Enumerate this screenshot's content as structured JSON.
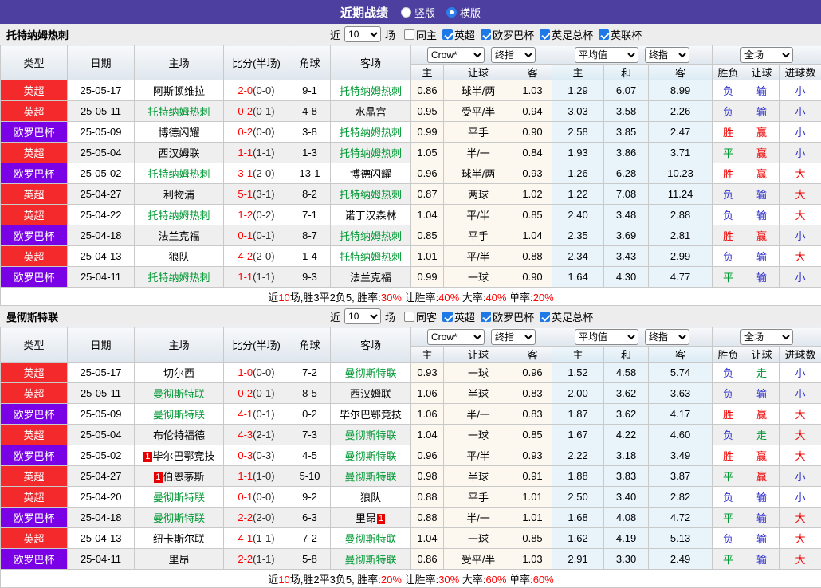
{
  "header": {
    "title": "近期战绩",
    "view_options": [
      {
        "label": "竖版",
        "checked": false
      },
      {
        "label": "横版",
        "checked": true
      }
    ]
  },
  "colors": {
    "topbar_purple": "#4c3f9f",
    "league_red": "#f4292c",
    "league_purple": "#7a00e6",
    "focus_team_green": "#009933",
    "score_red": "#ff0000",
    "win_red": "#f00000",
    "lose_blue": "#3333cc",
    "draw_green": "#009933",
    "checkbox_blue": "#1e79e6",
    "avg_col_bg": "#e9f4fa",
    "crow_col_bg": "#fcf7ef"
  },
  "table_selects": {
    "crow": "Crow*",
    "final1": "终指",
    "avg": "平均值",
    "final2": "终指",
    "full": "全场"
  },
  "columns": {
    "type": "类型",
    "date": "日期",
    "home": "主场",
    "score": "比分(半场)",
    "corner": "角球",
    "away": "客场",
    "crow_home": "主",
    "crow_handicap": "让球",
    "crow_away": "客",
    "avg_home": "主",
    "avg_draw": "和",
    "avg_away": "客",
    "result": "胜负",
    "handicap_result": "让球",
    "goals": "进球数"
  },
  "sections": [
    {
      "team": "托特纳姆热刺",
      "filter": {
        "near": "近",
        "games": "10",
        "unit": "场",
        "same": {
          "label": "同主",
          "checked": false
        },
        "leagues": [
          {
            "label": "英超",
            "checked": true
          },
          {
            "label": "欧罗巴杯",
            "checked": true
          },
          {
            "label": "英足总杯",
            "checked": true
          },
          {
            "label": "英联杯",
            "checked": true
          }
        ]
      },
      "rows": [
        {
          "type": "英超",
          "date": "25-05-17",
          "home": "阿斯顿维拉",
          "score": "2-0",
          "half": "(0-0)",
          "corner": "9-1",
          "away": "托特纳姆热刺",
          "crow_home": "0.86",
          "handicap": "球半/两",
          "crow_away": "1.03",
          "avg_home": "1.29",
          "avg_draw": "6.07",
          "avg_away": "8.99",
          "result": "负",
          "handicap_result": "输",
          "goals": "小"
        },
        {
          "type": "英超",
          "date": "25-05-11",
          "home": "托特纳姆热刺",
          "score": "0-2",
          "half": "(0-1)",
          "corner": "4-8",
          "away": "水晶宫",
          "crow_home": "0.95",
          "handicap": "受平/半",
          "crow_away": "0.94",
          "avg_home": "3.03",
          "avg_draw": "3.58",
          "avg_away": "2.26",
          "result": "负",
          "handicap_result": "输",
          "goals": "小"
        },
        {
          "type": "欧罗巴杯",
          "date": "25-05-09",
          "home": "博德闪耀",
          "score": "0-2",
          "half": "(0-0)",
          "corner": "3-8",
          "away": "托特纳姆热刺",
          "crow_home": "0.99",
          "handicap": "平手",
          "crow_away": "0.90",
          "avg_home": "2.58",
          "avg_draw": "3.85",
          "avg_away": "2.47",
          "result": "胜",
          "handicap_result": "赢",
          "goals": "小"
        },
        {
          "type": "英超",
          "date": "25-05-04",
          "home": "西汉姆联",
          "score": "1-1",
          "half": "(1-1)",
          "corner": "1-3",
          "away": "托特纳姆热刺",
          "crow_home": "1.05",
          "handicap": "半/一",
          "crow_away": "0.84",
          "avg_home": "1.93",
          "avg_draw": "3.86",
          "avg_away": "3.71",
          "result": "平",
          "handicap_result": "赢",
          "goals": "小"
        },
        {
          "type": "欧罗巴杯",
          "date": "25-05-02",
          "home": "托特纳姆热刺",
          "score": "3-1",
          "half": "(2-0)",
          "corner": "13-1",
          "away": "博德闪耀",
          "crow_home": "0.96",
          "handicap": "球半/两",
          "crow_away": "0.93",
          "avg_home": "1.26",
          "avg_draw": "6.28",
          "avg_away": "10.23",
          "result": "胜",
          "handicap_result": "赢",
          "goals": "大"
        },
        {
          "type": "英超",
          "date": "25-04-27",
          "home": "利物浦",
          "score": "5-1",
          "half": "(3-1)",
          "corner": "8-2",
          "away": "托特纳姆热刺",
          "crow_home": "0.87",
          "handicap": "两球",
          "crow_away": "1.02",
          "avg_home": "1.22",
          "avg_draw": "7.08",
          "avg_away": "11.24",
          "result": "负",
          "handicap_result": "输",
          "goals": "大"
        },
        {
          "type": "英超",
          "date": "25-04-22",
          "home": "托特纳姆热刺",
          "score": "1-2",
          "half": "(0-2)",
          "corner": "7-1",
          "away": "诺丁汉森林",
          "crow_home": "1.04",
          "handicap": "平/半",
          "crow_away": "0.85",
          "avg_home": "2.40",
          "avg_draw": "3.48",
          "avg_away": "2.88",
          "result": "负",
          "handicap_result": "输",
          "goals": "大"
        },
        {
          "type": "欧罗巴杯",
          "date": "25-04-18",
          "home": "法兰克福",
          "score": "0-1",
          "half": "(0-1)",
          "corner": "8-7",
          "away": "托特纳姆热刺",
          "crow_home": "0.85",
          "handicap": "平手",
          "crow_away": "1.04",
          "avg_home": "2.35",
          "avg_draw": "3.69",
          "avg_away": "2.81",
          "result": "胜",
          "handicap_result": "赢",
          "goals": "小"
        },
        {
          "type": "英超",
          "date": "25-04-13",
          "home": "狼队",
          "score": "4-2",
          "half": "(2-0)",
          "corner": "1-4",
          "away": "托特纳姆热刺",
          "crow_home": "1.01",
          "handicap": "平/半",
          "crow_away": "0.88",
          "avg_home": "2.34",
          "avg_draw": "3.43",
          "avg_away": "2.99",
          "result": "负",
          "handicap_result": "输",
          "goals": "大"
        },
        {
          "type": "欧罗巴杯",
          "date": "25-04-11",
          "home": "托特纳姆热刺",
          "score": "1-1",
          "half": "(1-1)",
          "corner": "9-3",
          "away": "法兰克福",
          "crow_home": "0.99",
          "handicap": "一球",
          "crow_away": "0.90",
          "avg_home": "1.64",
          "avg_draw": "4.30",
          "avg_away": "4.77",
          "result": "平",
          "handicap_result": "输",
          "goals": "小"
        }
      ],
      "summary": [
        {
          "text": "近"
        },
        {
          "text": "10",
          "red": true
        },
        {
          "text": "场,胜3平2负5, 胜率:"
        },
        {
          "text": "30%",
          "red": true
        },
        {
          "text": " 让胜率:"
        },
        {
          "text": "40%",
          "red": true
        },
        {
          "text": " 大率:"
        },
        {
          "text": "40%",
          "red": true
        },
        {
          "text": " 单率:"
        },
        {
          "text": "20%",
          "red": true
        }
      ]
    },
    {
      "team": "曼彻斯特联",
      "filter": {
        "near": "近",
        "games": "10",
        "unit": "场",
        "same": {
          "label": "同客",
          "checked": false
        },
        "leagues": [
          {
            "label": "英超",
            "checked": true
          },
          {
            "label": "欧罗巴杯",
            "checked": true
          },
          {
            "label": "英足总杯",
            "checked": true
          }
        ]
      },
      "rows": [
        {
          "type": "英超",
          "date": "25-05-17",
          "home": "切尔西",
          "score": "1-0",
          "half": "(0-0)",
          "corner": "7-2",
          "away": "曼彻斯特联",
          "crow_home": "0.93",
          "handicap": "一球",
          "crow_away": "0.96",
          "avg_home": "1.52",
          "avg_draw": "4.58",
          "avg_away": "5.74",
          "result": "负",
          "handicap_result": "走",
          "goals": "小"
        },
        {
          "type": "英超",
          "date": "25-05-11",
          "home": "曼彻斯特联",
          "score": "0-2",
          "half": "(0-1)",
          "corner": "8-5",
          "away": "西汉姆联",
          "crow_home": "1.06",
          "handicap": "半球",
          "crow_away": "0.83",
          "avg_home": "2.00",
          "avg_draw": "3.62",
          "avg_away": "3.63",
          "result": "负",
          "handicap_result": "输",
          "goals": "小"
        },
        {
          "type": "欧罗巴杯",
          "date": "25-05-09",
          "home": "曼彻斯特联",
          "score": "4-1",
          "half": "(0-1)",
          "corner": "0-2",
          "away": "毕尔巴鄂竞技",
          "crow_home": "1.06",
          "handicap": "半/一",
          "crow_away": "0.83",
          "avg_home": "1.87",
          "avg_draw": "3.62",
          "avg_away": "4.17",
          "result": "胜",
          "handicap_result": "赢",
          "goals": "大"
        },
        {
          "type": "英超",
          "date": "25-05-04",
          "home": "布伦特福德",
          "score": "4-3",
          "half": "(2-1)",
          "corner": "7-3",
          "away": "曼彻斯特联",
          "crow_home": "1.04",
          "handicap": "一球",
          "crow_away": "0.85",
          "avg_home": "1.67",
          "avg_draw": "4.22",
          "avg_away": "4.60",
          "result": "负",
          "handicap_result": "走",
          "goals": "大"
        },
        {
          "type": "欧罗巴杯",
          "date": "25-05-02",
          "home": "毕尔巴鄂竞技",
          "home_card": "1",
          "score": "0-3",
          "half": "(0-3)",
          "corner": "4-5",
          "away": "曼彻斯特联",
          "crow_home": "0.96",
          "handicap": "平/半",
          "crow_away": "0.93",
          "avg_home": "2.22",
          "avg_draw": "3.18",
          "avg_away": "3.49",
          "result": "胜",
          "handicap_result": "赢",
          "goals": "大"
        },
        {
          "type": "英超",
          "date": "25-04-27",
          "home": "伯恩茅斯",
          "home_card": "1",
          "score": "1-1",
          "half": "(1-0)",
          "corner": "5-10",
          "away": "曼彻斯特联",
          "crow_home": "0.98",
          "handicap": "半球",
          "crow_away": "0.91",
          "avg_home": "1.88",
          "avg_draw": "3.83",
          "avg_away": "3.87",
          "result": "平",
          "handicap_result": "赢",
          "goals": "小"
        },
        {
          "type": "英超",
          "date": "25-04-20",
          "home": "曼彻斯特联",
          "score": "0-1",
          "half": "(0-0)",
          "corner": "9-2",
          "away": "狼队",
          "crow_home": "0.88",
          "handicap": "平手",
          "crow_away": "1.01",
          "avg_home": "2.50",
          "avg_draw": "3.40",
          "avg_away": "2.82",
          "result": "负",
          "handicap_result": "输",
          "goals": "小"
        },
        {
          "type": "欧罗巴杯",
          "date": "25-04-18",
          "home": "曼彻斯特联",
          "score": "2-2",
          "half": "(2-0)",
          "corner": "6-3",
          "away": "里昂",
          "away_card": "1",
          "crow_home": "0.88",
          "handicap": "半/一",
          "crow_away": "1.01",
          "avg_home": "1.68",
          "avg_draw": "4.08",
          "avg_away": "4.72",
          "result": "平",
          "handicap_result": "输",
          "goals": "大"
        },
        {
          "type": "英超",
          "date": "25-04-13",
          "home": "纽卡斯尔联",
          "score": "4-1",
          "half": "(1-1)",
          "corner": "7-2",
          "away": "曼彻斯特联",
          "crow_home": "1.04",
          "handicap": "一球",
          "crow_away": "0.85",
          "avg_home": "1.62",
          "avg_draw": "4.19",
          "avg_away": "5.13",
          "result": "负",
          "handicap_result": "输",
          "goals": "大"
        },
        {
          "type": "欧罗巴杯",
          "date": "25-04-11",
          "home": "里昂",
          "score": "2-2",
          "half": "(1-1)",
          "corner": "5-8",
          "away": "曼彻斯特联",
          "crow_home": "0.86",
          "handicap": "受平/半",
          "crow_away": "1.03",
          "avg_home": "2.91",
          "avg_draw": "3.30",
          "avg_away": "2.49",
          "result": "平",
          "handicap_result": "输",
          "goals": "大"
        }
      ],
      "summary": [
        {
          "text": "近"
        },
        {
          "text": "10",
          "red": true
        },
        {
          "text": "场,胜2平3负5, 胜率:"
        },
        {
          "text": "20%",
          "red": true
        },
        {
          "text": " 让胜率:"
        },
        {
          "text": "30%",
          "red": true
        },
        {
          "text": " 大率:"
        },
        {
          "text": "60%",
          "red": true
        },
        {
          "text": " 单率:"
        },
        {
          "text": "60%",
          "red": true
        }
      ]
    }
  ]
}
